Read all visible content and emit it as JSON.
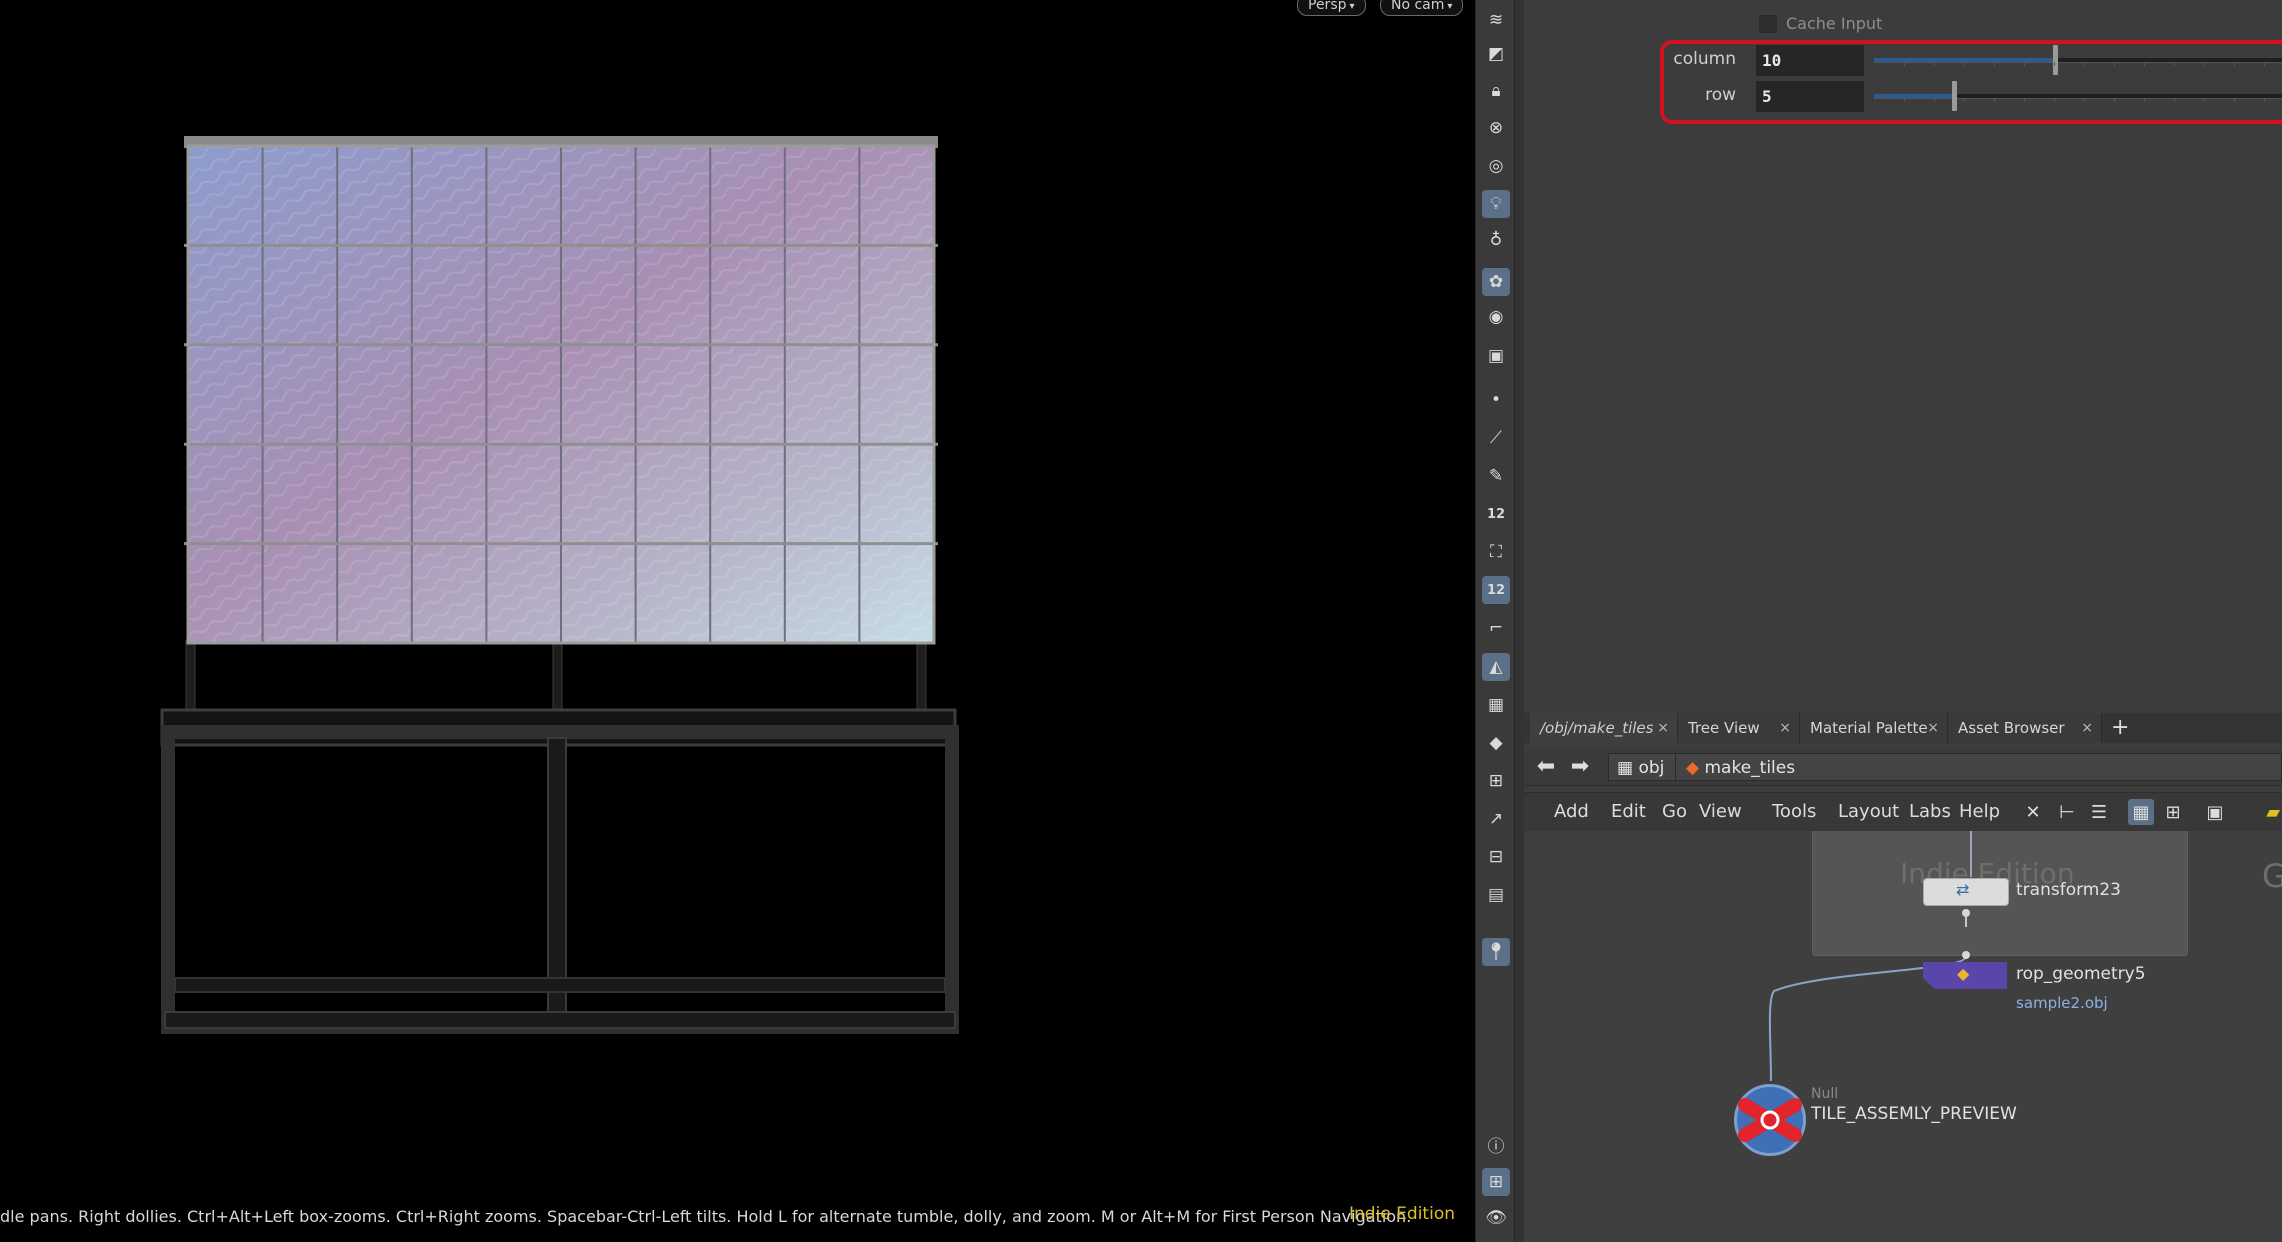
{
  "viewport": {
    "persp_label": "Persp",
    "cam_label": "No cam",
    "status_text": "dle pans. Right dollies. Ctrl+Alt+Left box-zooms. Ctrl+Right zooms. Spacebar-Ctrl-Left tilts. Hold L for alternate tumble, dolly, and zoom. M or Alt+M for First Person Navigation.",
    "edition_label": "Indie Edition",
    "tile_grid": {
      "columns": 10,
      "rows": 5
    }
  },
  "toolbar": {
    "icons": [
      "layers-icon",
      "uv-icon",
      "lock-icon",
      "ghost-icon",
      "shading-icon",
      "light-icon",
      "light-link-icon",
      "display-options-icon",
      "camera-icon",
      "render-icon",
      "point-icon",
      "brush-icon",
      "pick-icon",
      "point-numbers-icon",
      "paint-icon",
      "prim-numbers-icon",
      "guide-icon",
      "grid-icon",
      "checker-icon",
      "diamond-icon",
      "map-icon",
      "vector-icon",
      "snapshot-icon",
      "image-icon",
      "pin-icon",
      "info-icon",
      "layout-icon",
      "eye-icon"
    ],
    "point_numbers_label": "12",
    "prim_numbers_label": "12"
  },
  "params": {
    "cache_input_label": "Cache Input",
    "column": {
      "label": "column",
      "value": "10",
      "slider_fraction": 0.43
    },
    "row": {
      "label": "row",
      "value": "5",
      "slider_fraction": 0.19
    }
  },
  "network": {
    "tabs": [
      {
        "label": "/obj/make_tiles"
      },
      {
        "label": "Tree View"
      },
      {
        "label": "Material Palette"
      },
      {
        "label": "Asset Browser"
      }
    ],
    "tab_add": "+",
    "path": {
      "root": "obj",
      "current": "make_tiles"
    },
    "menu": [
      "Add",
      "Edit",
      "Go",
      "View",
      "Tools",
      "Layout",
      "Labs",
      "Help"
    ],
    "watermark": "Indie Edition",
    "watermark_edge": "G",
    "nodes": {
      "transform": {
        "name": "transform23"
      },
      "rop": {
        "name": "rop_geometry5",
        "output": "sample2.obj"
      },
      "null": {
        "type": "Null",
        "name": "TILE_ASSEMLY_PREVIEW"
      }
    }
  },
  "colors": {
    "highlight": "#d5101f",
    "slider_fill": "#2c5a92",
    "edition_yellow": "#d8c02a",
    "rop_node": "#5a46a8",
    "null_node": "#e2252c"
  }
}
